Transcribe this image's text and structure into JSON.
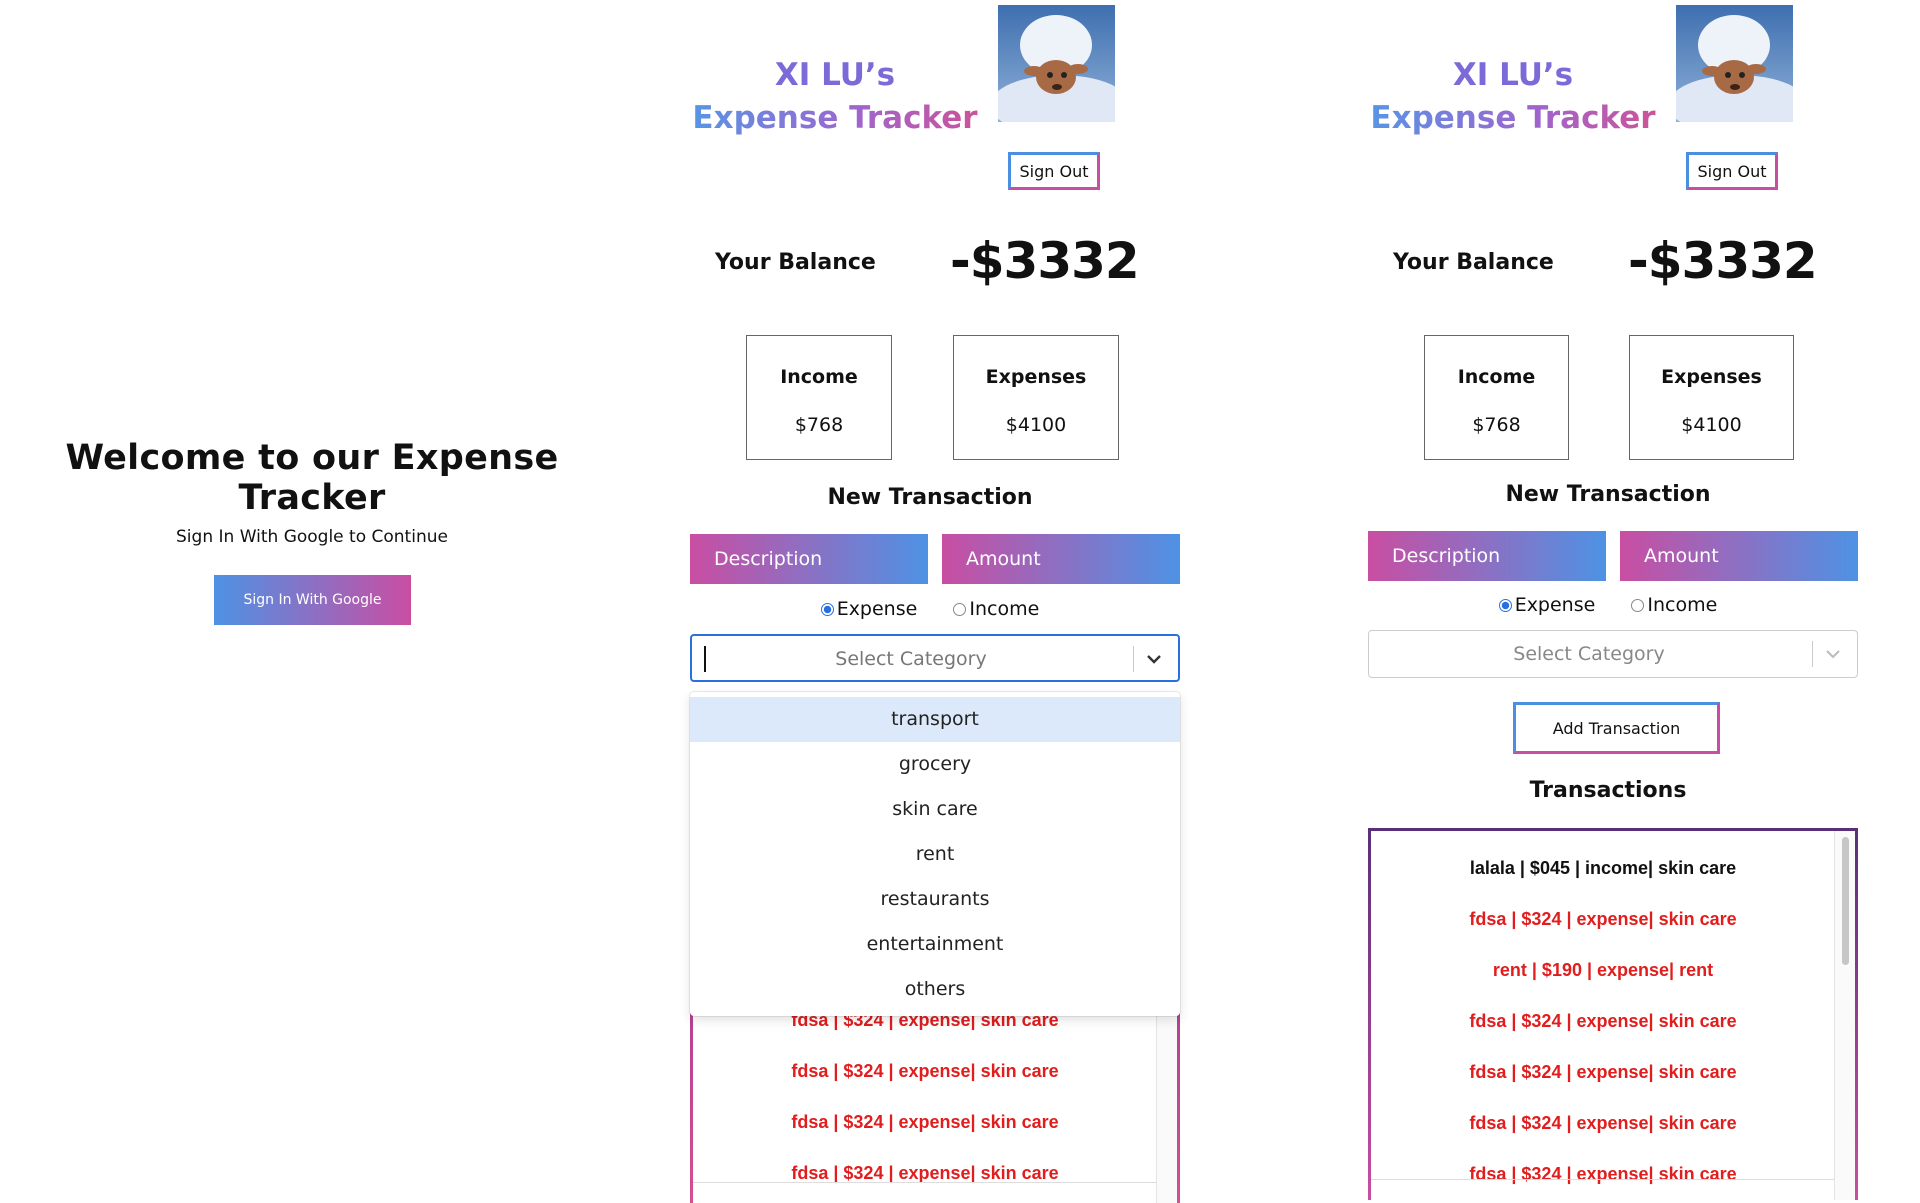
{
  "signin": {
    "title": "Welcome to our Expense Tracker",
    "subtitle": "Sign In With Google to Continue",
    "button_label": "Sign In With Google"
  },
  "tracker": {
    "title_line1": "XI LU’s",
    "title_line2": "Expense Tracker",
    "sign_out_label": "Sign Out",
    "balance_label": "Your Balance",
    "balance_value": "-$3332",
    "income_label": "Income",
    "income_value": "$768",
    "expenses_label": "Expenses",
    "expenses_value": "$4100",
    "new_transaction_label": "New Transaction",
    "description_placeholder": "Description",
    "amount_placeholder": "Amount",
    "type_options": [
      "Expense",
      "Income"
    ],
    "type_selected": "Expense",
    "category_placeholder": "Select Category",
    "category_options": [
      "transport",
      "grocery",
      "skin care",
      "rent",
      "restaurants",
      "entertainment",
      "others"
    ],
    "add_button_label": "Add Transaction",
    "transactions_label": "Transactions",
    "transactions": [
      {
        "text": "lalala | $045 | income| skin care",
        "type": "income"
      },
      {
        "text": "fdsa | $324 | expense| skin care",
        "type": "expense"
      },
      {
        "text": "rent | $190 | expense| rent",
        "type": "expense"
      },
      {
        "text": "fdsa | $324 | expense| skin care",
        "type": "expense"
      },
      {
        "text": "fdsa | $324 | expense| skin care",
        "type": "expense"
      },
      {
        "text": "fdsa | $324 | expense| skin care",
        "type": "expense"
      },
      {
        "text": "fdsa | $324 | expense| skin care",
        "type": "expense"
      }
    ]
  },
  "colors": {
    "gradient_blue": "#4e92e4",
    "gradient_pink": "#c94ea2",
    "expense_red": "#e11d1d",
    "focus_blue": "#2a6fdf"
  },
  "icons": [
    "chevron-down-icon",
    "avatar-image"
  ]
}
